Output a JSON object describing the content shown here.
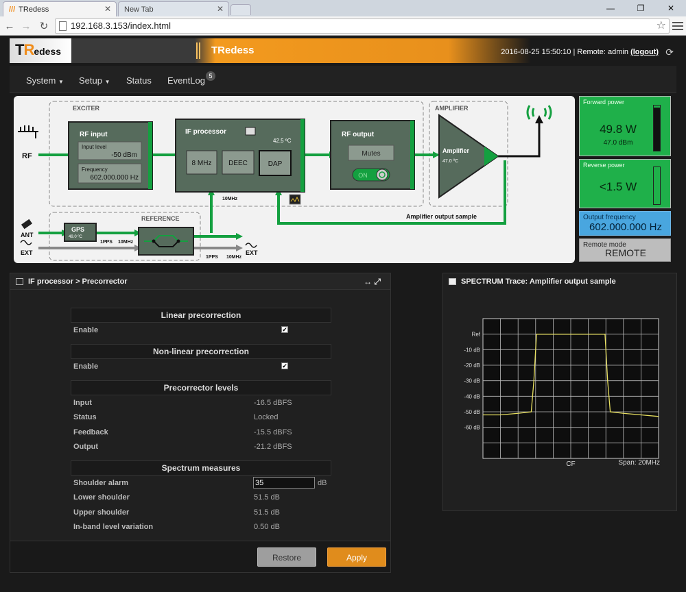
{
  "browser": {
    "tabs": [
      {
        "label": "TRedess"
      },
      {
        "label": "New Tab"
      }
    ],
    "url": "192.168.3.153/index.html"
  },
  "header": {
    "logo": {
      "t": "T",
      "r": "R",
      "rest": "edess"
    },
    "title": "TRedess",
    "datetime": "2016-08-25 15:50:10",
    "remote_label": "| Remote: admin",
    "logout": "(logout)"
  },
  "nav": {
    "items": [
      "System",
      "Setup",
      "Status",
      "EventLog"
    ],
    "eventlog_badge": "5"
  },
  "diagram": {
    "exciter_label": "EXCITER",
    "amplifier_group_label": "AMPLIFIER",
    "reference_label": "REFERENCE",
    "rf_label": "RF",
    "ant_label": "ANT",
    "ext_label": "EXT",
    "ext_out_label": "EXT",
    "rf_input": {
      "title": "RF input",
      "level_label": "Input level",
      "level_value": "-50 dBm",
      "freq_label": "Frequency",
      "freq_value": "602.000.000 Hz"
    },
    "if_processor": {
      "title": "IF processor",
      "temp": "42.5 ºC",
      "buttons": [
        "8 MHz",
        "DEEC",
        "DAP"
      ]
    },
    "rf_output": {
      "title": "RF output",
      "mutes": "Mutes",
      "on": "ON"
    },
    "amplifier": {
      "title": "Amplifier",
      "temp": "47.0 ºC"
    },
    "gps": {
      "title": "GPS",
      "temp": "49.0 ºC"
    },
    "lbl_10mhz_top": "10MHz",
    "lbl_1pps_a": "1PPS",
    "lbl_10mhz_a": "10MHz",
    "lbl_1pps_b": "1PPS",
    "lbl_10mhz_b": "10MHz",
    "amp_sample": "Amplifier output sample"
  },
  "side": {
    "forward": {
      "label": "Forward power",
      "value": "49.8 W",
      "sub": "47.0 dBm",
      "level": 0.95
    },
    "reverse": {
      "label": "Reverse power",
      "value": "<1.5 W",
      "level": 0.0
    },
    "output_freq": {
      "label": "Output frequency",
      "value": "602.000.000 Hz"
    },
    "remote_mode": {
      "label": "Remote mode",
      "value": "REMOTE"
    }
  },
  "precorrector": {
    "title": "IF processor > Precorrector",
    "tools": "↔ ⤢",
    "linear": {
      "header": "Linear precorrection",
      "enable_label": "Enable",
      "enabled": "✔"
    },
    "nonlinear": {
      "header": "Non-linear precorrection",
      "enable_label": "Enable",
      "enabled": "✔"
    },
    "levels": {
      "header": "Precorrector levels",
      "rows": [
        {
          "label": "Input",
          "value": "-16.5 dBFS"
        },
        {
          "label": "Status",
          "value": "Locked"
        },
        {
          "label": "Feedback",
          "value": "-15.5 dBFS"
        },
        {
          "label": "Output",
          "value": "-21.2 dBFS"
        }
      ]
    },
    "spectrum": {
      "header": "Spectrum measures",
      "shoulder_alarm_label": "Shoulder alarm",
      "shoulder_alarm_value": "35",
      "shoulder_alarm_unit": "dB",
      "rows": [
        {
          "label": "Lower shoulder",
          "value": "51.5 dB"
        },
        {
          "label": "Upper shoulder",
          "value": "51.5 dB"
        },
        {
          "label": "In-band level variation",
          "value": "0.50 dB"
        }
      ]
    },
    "restore": "Restore",
    "apply": "Apply"
  },
  "spectrum_panel": {
    "title": "SPECTRUM Trace: Amplifier output sample",
    "cf_label": "CF",
    "span_label": "Span: 20MHz"
  },
  "chart_data": {
    "type": "line",
    "title": "SPECTRUM Trace: Amplifier output sample",
    "xlabel": "CF",
    "span": "Span: 20MHz",
    "yticks": [
      "Ref",
      "-10 dB",
      "-20 dB",
      "-30 dB",
      "-40 dB",
      "-50 dB",
      "-60 dB"
    ],
    "ytick_values": [
      0,
      -10,
      -20,
      -30,
      -40,
      -50,
      -60
    ],
    "ylim": [
      -80,
      10
    ],
    "xlim": [
      -10,
      10
    ],
    "grid": true,
    "line_color": "#e8e060",
    "series": [
      {
        "x": [
          -10,
          -8,
          -6,
          -4.5,
          -4.2,
          -3.9,
          3.9,
          4.2,
          4.5,
          6,
          8,
          10
        ],
        "y": [
          -52,
          -52,
          -51,
          -50,
          -30,
          0,
          0,
          -30,
          -50,
          -51,
          -52,
          -53
        ]
      }
    ]
  }
}
